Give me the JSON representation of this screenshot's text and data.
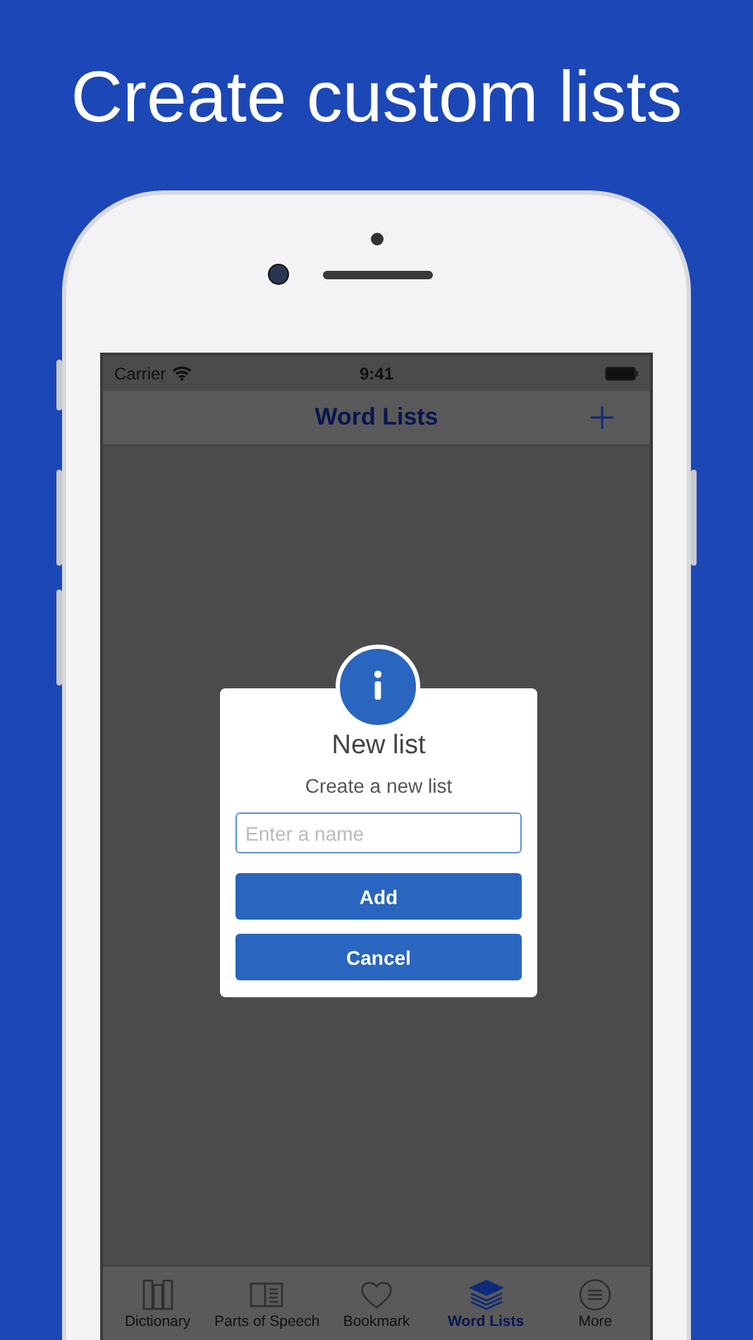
{
  "headline": "Create custom lists",
  "status_bar": {
    "carrier": "Carrier",
    "time": "9:41"
  },
  "nav_bar": {
    "title": "Word Lists"
  },
  "dialog": {
    "title": "New list",
    "message": "Create a new list",
    "input": {
      "placeholder": "Enter a name"
    },
    "buttons": [
      {
        "label": "Add"
      },
      {
        "label": "Cancel"
      }
    ]
  },
  "tab_bar": [
    {
      "label": "Dictionary",
      "kind": "books",
      "selected": false
    },
    {
      "label": "Parts of Speech",
      "kind": "book",
      "selected": false
    },
    {
      "label": "Bookmark",
      "kind": "heart",
      "selected": false
    },
    {
      "label": "Word Lists",
      "kind": "stack",
      "selected": true
    },
    {
      "label": "More",
      "kind": "more",
      "selected": false
    }
  ]
}
